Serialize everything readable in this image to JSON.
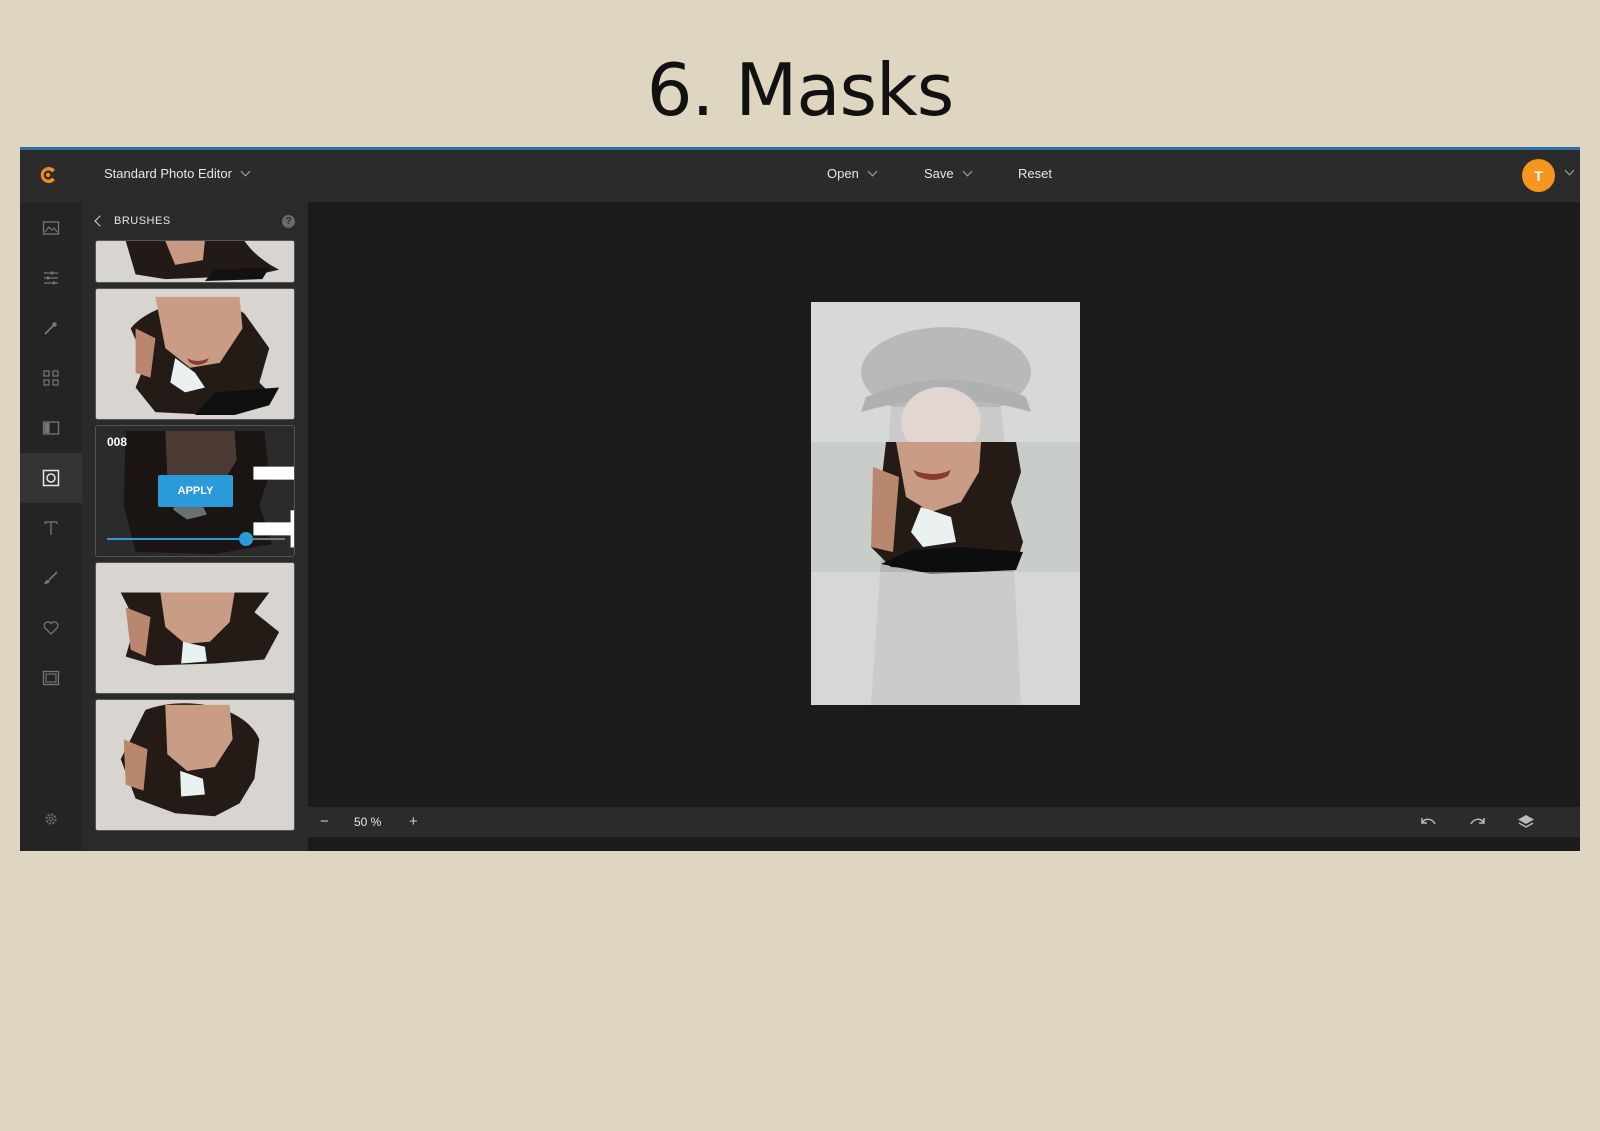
{
  "slide": {
    "title": "6. Masks"
  },
  "topbar": {
    "editor_label": "Standard Photo Editor",
    "open_label": "Open",
    "save_label": "Save",
    "reset_label": "Reset",
    "avatar_initial": "T",
    "avatar_color": "#f6961e"
  },
  "rail": {
    "items": [
      "image-icon",
      "adjust-sliders-icon",
      "magic-wand-icon",
      "grid-icon",
      "layout-icon",
      "mask-icon",
      "text-icon",
      "brush-icon",
      "heart-icon",
      "frame-icon",
      "gear-icon"
    ],
    "active": "mask-icon"
  },
  "panel": {
    "title": "BRUSHES",
    "help_glyph": "?",
    "active_card": {
      "label": "008",
      "apply_label": "APPLY",
      "intensity": 0.78
    }
  },
  "bottom": {
    "zoom_minus": "−",
    "zoom_value": "50 %",
    "zoom_plus": "+"
  },
  "colors": {
    "accent": "#2a9bd8",
    "topbar_accent": "#2b6ea8",
    "slide_bg": "#dfd6c2"
  }
}
